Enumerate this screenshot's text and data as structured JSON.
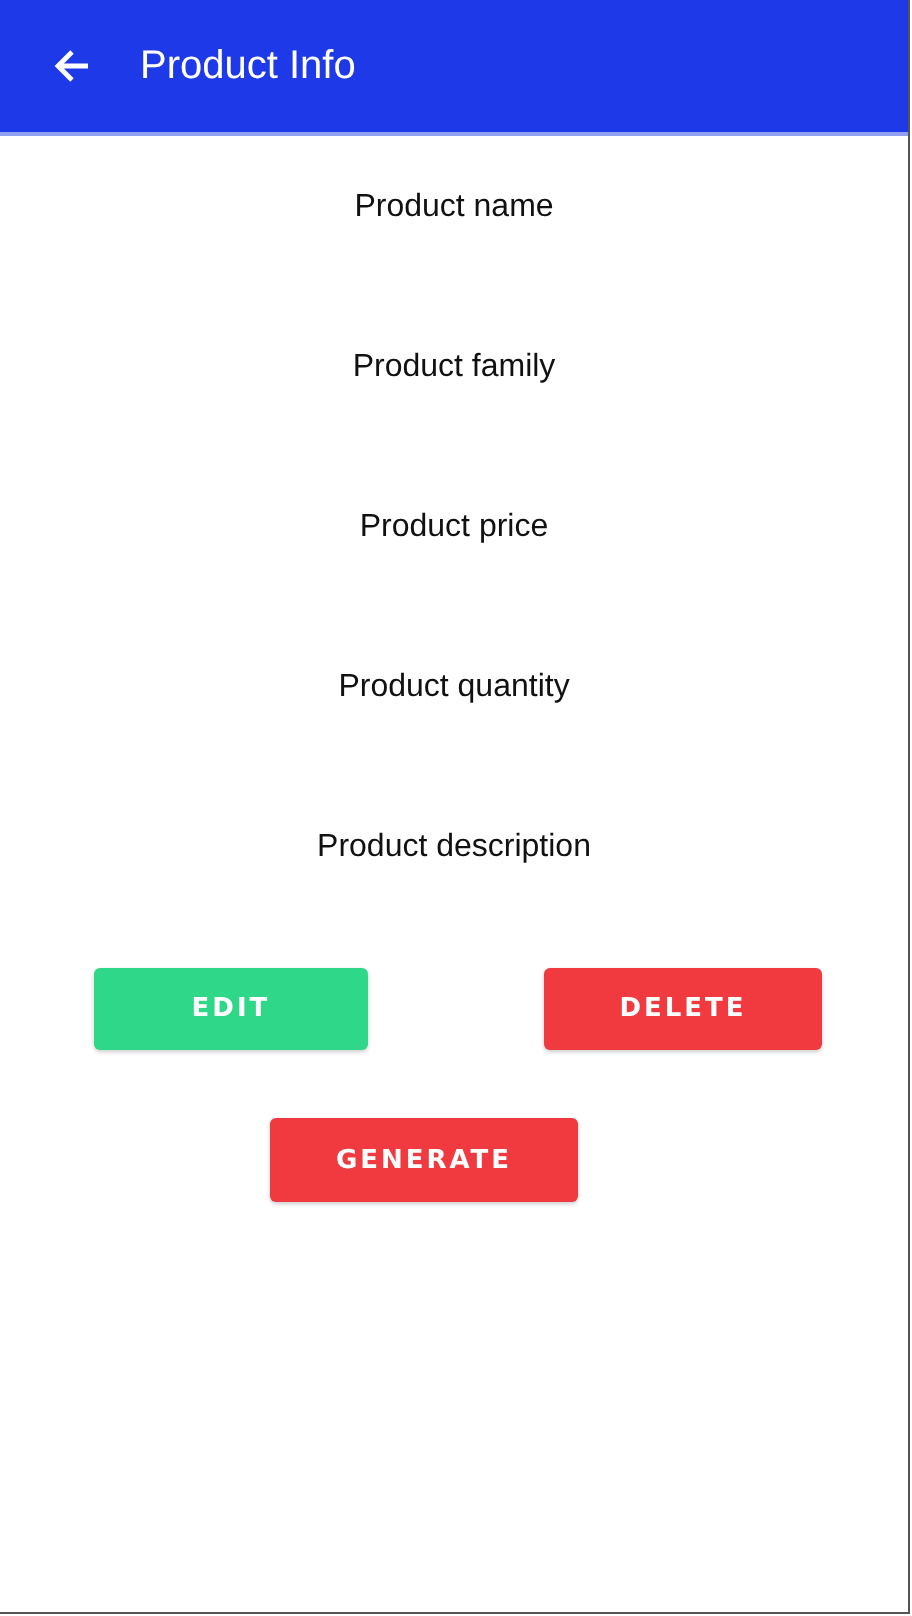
{
  "app_bar": {
    "title": "Product Info"
  },
  "fields": [
    {
      "label": "Product name"
    },
    {
      "label": "Product family"
    },
    {
      "label": "Product price"
    },
    {
      "label": "Product quantity"
    },
    {
      "label": "Product description"
    }
  ],
  "buttons": [
    {
      "label": "EDIT",
      "color": "#2ed888"
    },
    {
      "label": "DELETE",
      "color": "#f03a40"
    },
    {
      "label": "GENERATE",
      "color": "#f03a40"
    }
  ]
}
